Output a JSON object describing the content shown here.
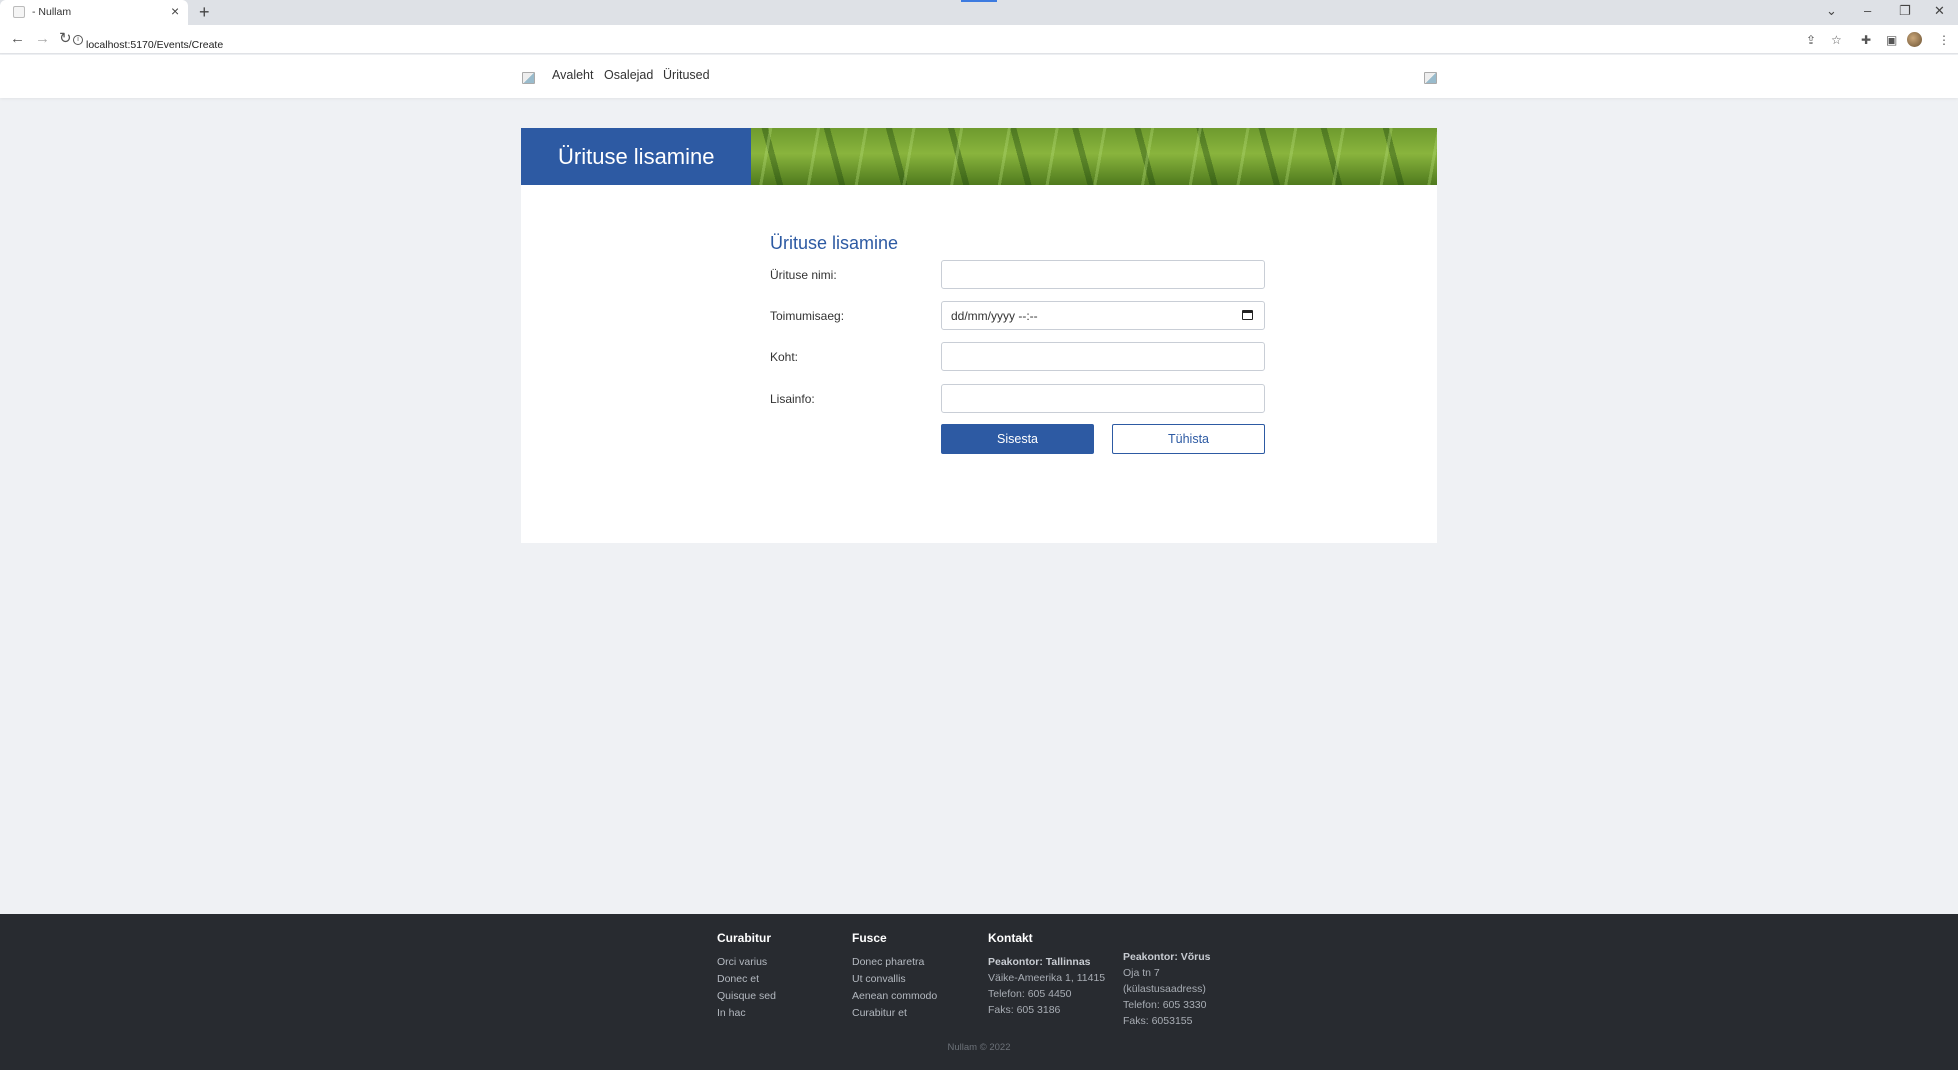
{
  "browser": {
    "tab_title": "- Nullam",
    "url": "localhost:5170/Events/Create"
  },
  "nav": {
    "items": [
      "Avaleht",
      "Osalejad",
      "Üritused"
    ]
  },
  "banner": {
    "title": "Ürituse lisamine"
  },
  "form": {
    "heading": "Ürituse lisamine",
    "name_label": "Ürituse nimi:",
    "name_value": "",
    "time_label": "Toimumisaeg:",
    "time_placeholder": "dd/mm/yyyy --:--",
    "place_label": "Koht:",
    "place_value": "",
    "info_label": "Lisainfo:",
    "info_value": "",
    "submit_label": "Sisesta",
    "cancel_label": "Tühista"
  },
  "footer": {
    "col1": {
      "heading": "Curabitur",
      "links": [
        "Orci varius",
        "Donec et",
        "Quisque sed",
        "In hac"
      ]
    },
    "col2": {
      "heading": "Fusce",
      "links": [
        "Donec pharetra",
        "Ut convallis",
        "Aenean commodo",
        "Curabitur et"
      ]
    },
    "col3": {
      "heading": "Kontakt",
      "office_title": "Peakontor: Tallinnas",
      "lines": [
        "Väike-Ameerika 1, 11415",
        "Telefon: 605 4450",
        "Faks: 605 3186"
      ]
    },
    "col4": {
      "office_title": "Peakontor: Võrus",
      "lines": [
        "Oja tn 7",
        "(külastusaadress)",
        "Telefon: 605 3330",
        "Faks: 6053155"
      ]
    },
    "copyright": "Nullam © 2022"
  },
  "colors": {
    "brand_blue": "#2d5aa3",
    "footer_bg": "#282b30",
    "page_bg": "#eff1f4"
  },
  "icons": [
    "page-favicon-icon",
    "close-tab-icon",
    "new-tab-icon",
    "back-icon",
    "forward-icon",
    "reload-icon",
    "site-info-icon",
    "share-icon",
    "bookmark-star-icon",
    "extensions-icon",
    "side-panel-icon",
    "menu-dots-icon",
    "calendar-icon"
  ]
}
